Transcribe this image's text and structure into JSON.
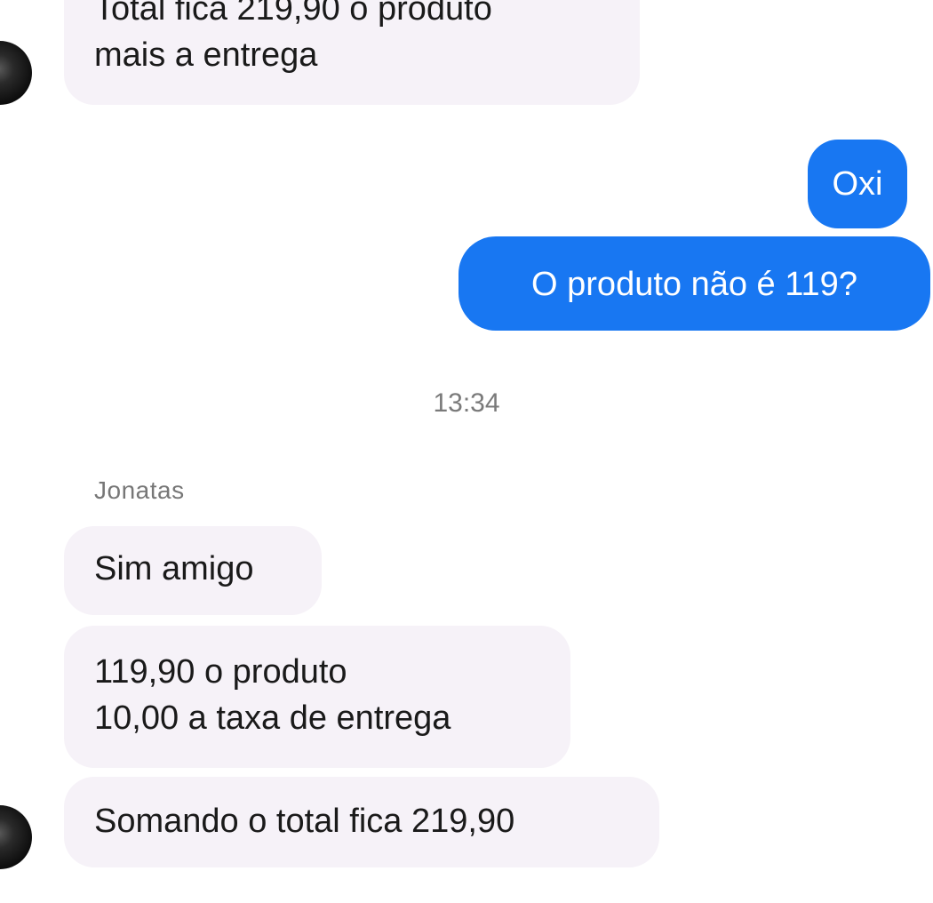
{
  "chat": {
    "prev_message": "Total fica 219,90 o produto\nmais a entrega",
    "out_messages": [
      "Oxi",
      "O produto não é 119?"
    ],
    "timestamp": "13:34",
    "sender_name": "Jonatas",
    "in_messages": [
      "Sim amigo",
      "119,90 o produto\n10,00 a taxa de entrega",
      "Somando o total fica 219,90"
    ]
  },
  "colors": {
    "outgoing_bubble": "#1877f2",
    "incoming_bubble": "#f6f2f8"
  },
  "icons": {
    "avatar": "contact-avatar"
  }
}
